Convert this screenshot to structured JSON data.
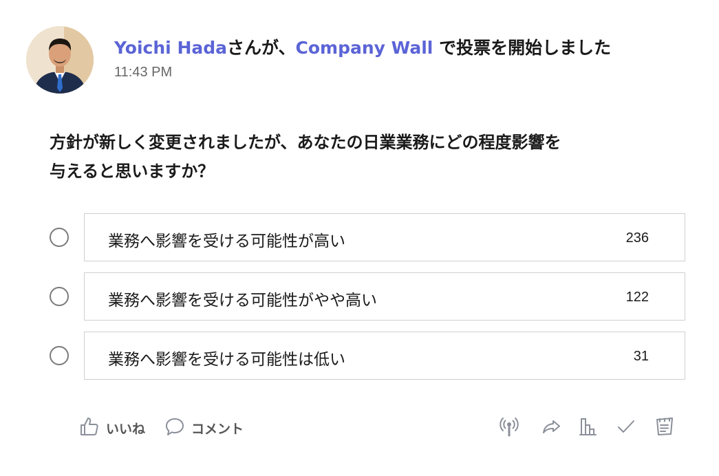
{
  "post": {
    "author": "Yoichi Hada",
    "action_prefix": "さんが、",
    "target": "Company Wall",
    "action_suffix": " で投票を開始しました",
    "timestamp": "11:43 PM"
  },
  "poll": {
    "question_line1": "方針が新しく変更されましたが、あなたの日業業務にどの程度影響を",
    "question_line2": "与えると思いますか？",
    "options": [
      {
        "label": "業務へ影響を受ける可能性が高い",
        "count": "236"
      },
      {
        "label": "業務へ影響を受ける可能性がやや高い",
        "count": "122"
      },
      {
        "label": "業務へ影響を受ける可能性は低い",
        "count": "31"
      }
    ]
  },
  "actions": {
    "like_label": "いいね",
    "comment_label": "コメント",
    "icons": [
      "like-icon",
      "comment-icon",
      "broadcast-icon",
      "share-icon",
      "stats-icon",
      "check-icon",
      "notes-icon"
    ]
  },
  "colors": {
    "link": "#5b64d6",
    "icon": "#8a8f99"
  }
}
